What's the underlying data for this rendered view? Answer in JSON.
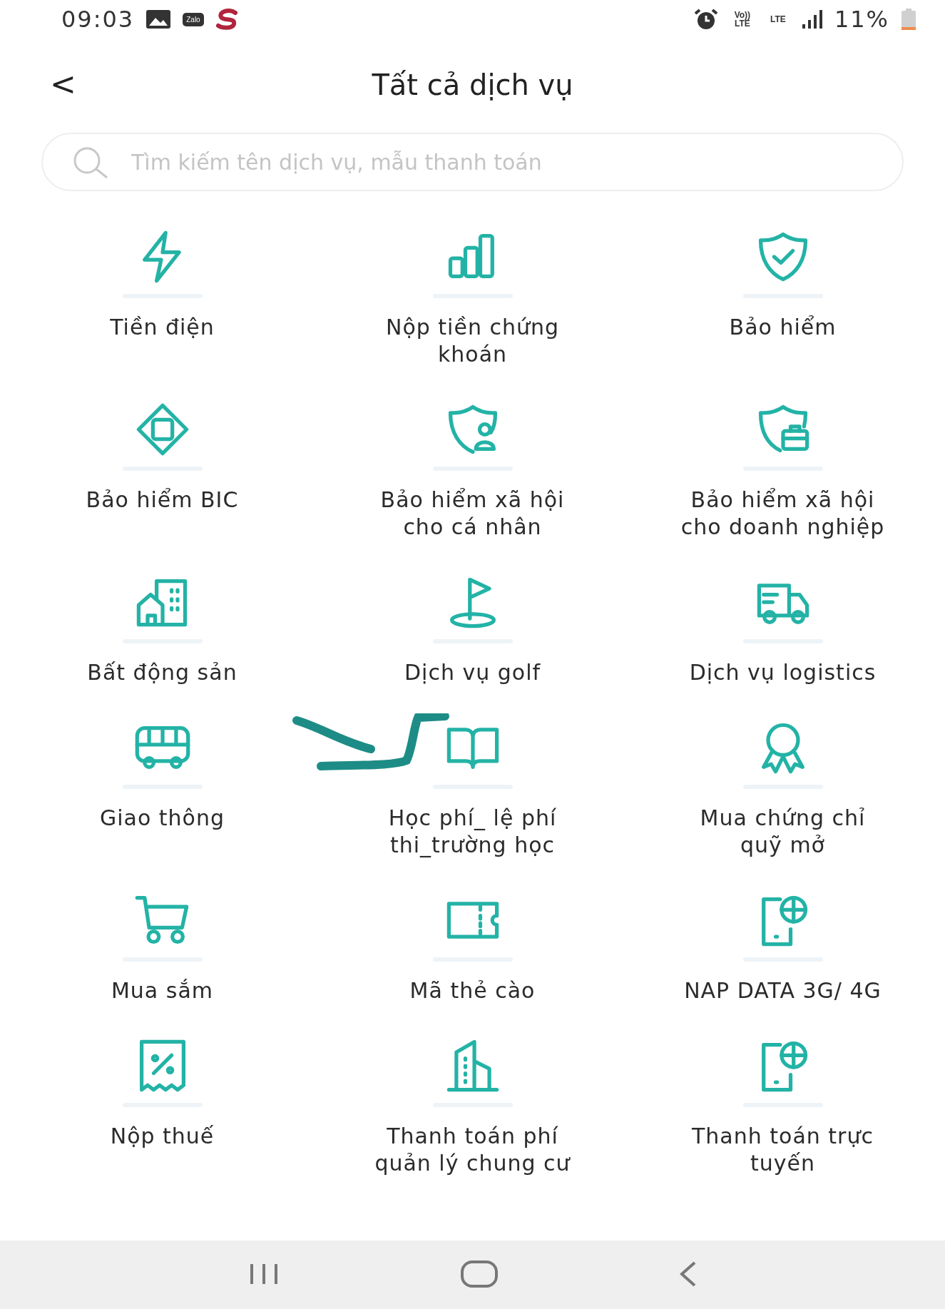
{
  "status_bar": {
    "time": "09:03",
    "apps": [
      {
        "kind": "gallery"
      },
      {
        "kind": "zalo",
        "text": "Zalo"
      },
      {
        "kind": "swirl"
      }
    ],
    "indicators": [
      {
        "kind": "alarm"
      },
      {
        "kind": "volte",
        "text": "Vo)) LTE"
      },
      {
        "kind": "lte",
        "text": "LTE"
      },
      {
        "kind": "signal"
      }
    ],
    "battery": "11%"
  },
  "header": {
    "back": "<",
    "title": "Tất cả dịch vụ"
  },
  "search": {
    "placeholder": "Tìm kiếm tên dịch vụ, mẫu thanh toán"
  },
  "services": [
    {
      "kind": "bolt",
      "label": "Tiền điện"
    },
    {
      "kind": "bars",
      "label": "Nộp tiền chứng khoán"
    },
    {
      "kind": "shield-check",
      "label": "Bảo hiểm"
    },
    {
      "kind": "diamond",
      "label": "Bảo hiểm BIC"
    },
    {
      "kind": "shield-person",
      "label": "Bảo hiểm xã hội cho cá nhân"
    },
    {
      "kind": "shield-case",
      "label": "Bảo hiểm xã hội cho doanh nghiệp"
    },
    {
      "kind": "buildings",
      "label": "Bất động sản"
    },
    {
      "kind": "flag",
      "label": "Dịch vụ golf"
    },
    {
      "kind": "truck",
      "label": "Dịch vụ logistics"
    },
    {
      "kind": "bus",
      "label": "Giao thông"
    },
    {
      "kind": "book",
      "label": "Học phí_ lệ phí thi_trường học"
    },
    {
      "kind": "award",
      "label": "Mua chứng chỉ quỹ mở"
    },
    {
      "kind": "cart",
      "label": "Mua sắm"
    },
    {
      "kind": "ticket",
      "label": "Mã thẻ cào"
    },
    {
      "kind": "phone-globe",
      "label": "NAP DATA 3G/ 4G"
    },
    {
      "kind": "receipt",
      "label": "Nộp thuế"
    },
    {
      "kind": "tower",
      "label": "Thanh toán phí quản lý chung cư"
    },
    {
      "kind": "phone-globe",
      "label": "Thanh toán trực tuyến"
    }
  ]
}
